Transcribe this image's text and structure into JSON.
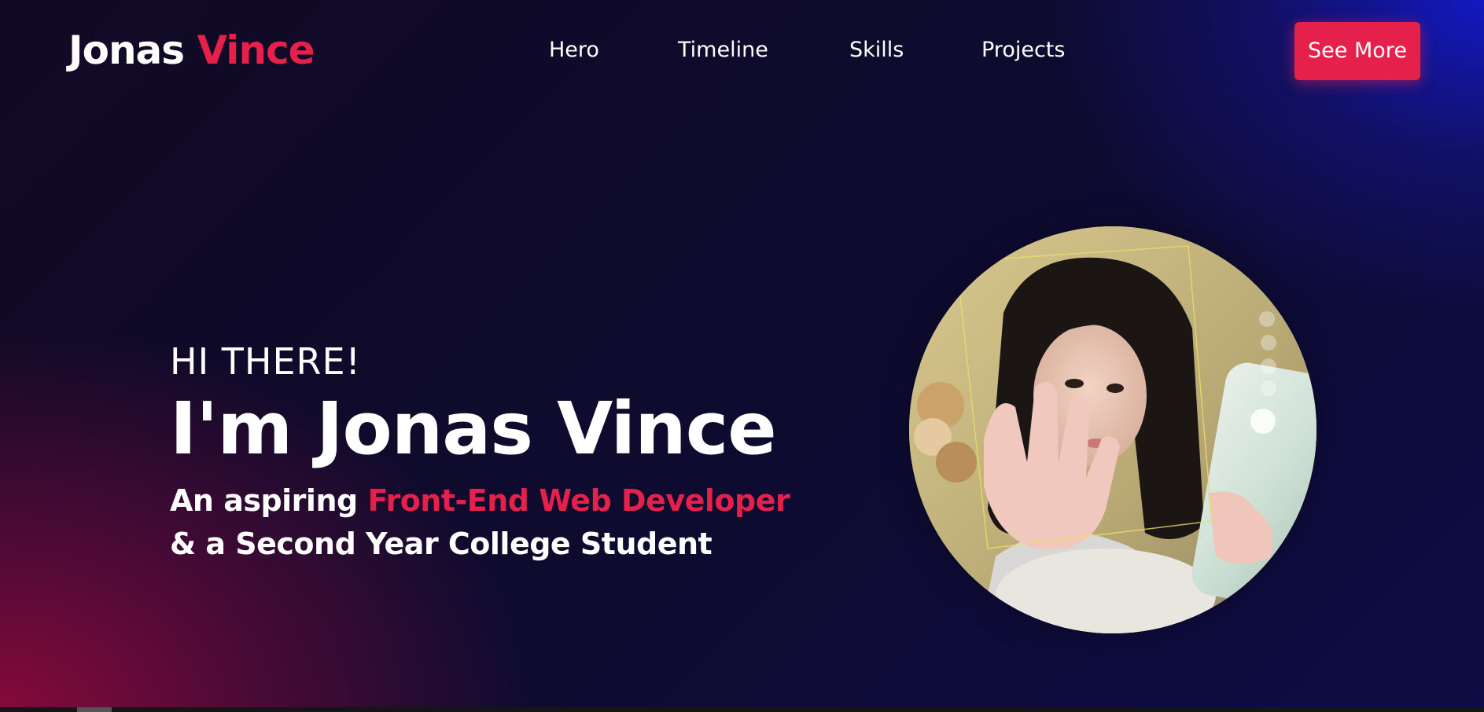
{
  "header": {
    "logo_first": "Jonas",
    "logo_last": "Vince",
    "nav": [
      {
        "label": "Hero"
      },
      {
        "label": "Timeline"
      },
      {
        "label": "Skills"
      },
      {
        "label": "Projects"
      }
    ],
    "cta_label": "See More"
  },
  "hero": {
    "greeting": "HI THERE!",
    "title": "I'm Jonas Vince",
    "tagline_prefix": "An aspiring ",
    "tagline_highlight": "Front-End Web Developer",
    "tagline_second": "& a Second Year College Student",
    "photo_icon": "profile-photo"
  },
  "colors": {
    "accent": "#e5204a",
    "text": "#ffffff",
    "background_dark": "#0d0b2e",
    "gradient_bottom_left": "#8c0a3c",
    "gradient_top_right": "#1419c8"
  }
}
